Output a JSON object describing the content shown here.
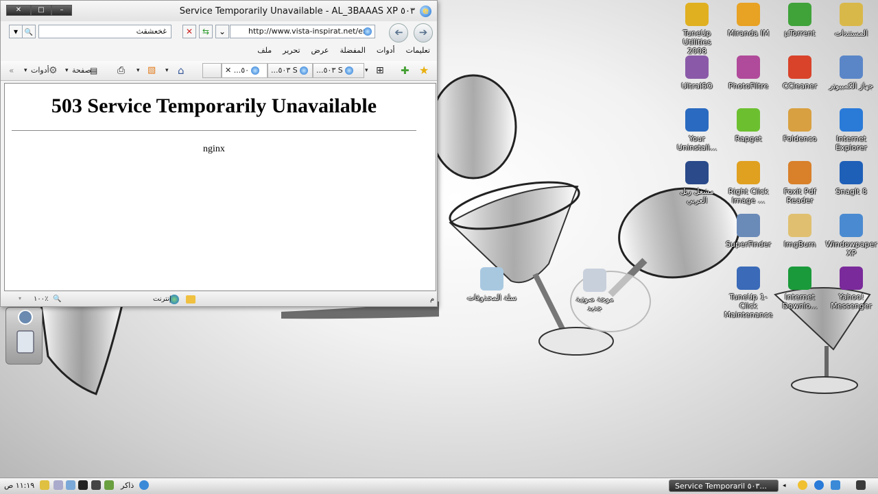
{
  "window": {
    "title": "Service Temporarily Unavailable - AL_3BAAAS XP ٥٠٣",
    "caption_minimize": "–",
    "caption_maximize": "□",
    "caption_close": "✕"
  },
  "address_bar": {
    "url": "http://www.vista-inspirat.net/en/",
    "dropdown_glyph": "⌄",
    "refresh_glyph": "⇆",
    "stop_glyph": "✕",
    "search_value": "غخعشقث",
    "search_glyph": "🔍",
    "search_dropdown_glyph": "▾"
  },
  "menu": {
    "items": [
      "ملف",
      "تحرير",
      "عرض",
      "المفضلة",
      "أدوات",
      "تعليمات"
    ]
  },
  "toolbar": {
    "tools_label": "أدوات",
    "page_label": "صفحة",
    "tabs": [
      {
        "label": "...٥٠٣ S"
      },
      {
        "label": "...٥٠٣ S"
      },
      {
        "label": "...٥٠"
      }
    ],
    "tab_close": "✕"
  },
  "page": {
    "heading": "503 Service Temporarily Unavailable",
    "server": "nginx"
  },
  "status_bar": {
    "left_char": "م",
    "zone": "إنترنت",
    "zoom": "١٠٠٪"
  },
  "desktop_icons": [
    {
      "label": "المستندات",
      "icon": "folder-icon",
      "color": "#d9b84a"
    },
    {
      "label": "µTorrent",
      "icon": "utorrent-icon",
      "color": "#3fa33a"
    },
    {
      "label": "Miranda IM",
      "icon": "miranda-icon",
      "color": "#e8a224"
    },
    {
      "label": "TuneUp Utilities\n2008",
      "icon": "tuneup-icon",
      "color": "#e0b020"
    },
    {
      "label": "جهاز الكمبيوتر",
      "icon": "computer-icon",
      "color": "#5a86c8"
    },
    {
      "label": "CCleaner",
      "icon": "ccleaner-icon",
      "color": "#d8432a"
    },
    {
      "label": "PhotoFiltre",
      "icon": "photofiltre-icon",
      "color": "#b04a9a"
    },
    {
      "label": "UltraISO",
      "icon": "ultraiso-icon",
      "color": "#8a5aa8"
    },
    {
      "label": "Internet\nExplorer",
      "icon": "internet-explorer-icon",
      "color": "#2a7ad8"
    },
    {
      "label": "Foldenco",
      "icon": "foldenco-icon",
      "color": "#d8a040"
    },
    {
      "label": "Rapget",
      "icon": "rapget-icon",
      "color": "#6cc030"
    },
    {
      "label": "Your\nUninstall...",
      "icon": "uninstaller-icon",
      "color": "#2a6ac0"
    },
    {
      "label": "SnagIt 8",
      "icon": "snagit-icon",
      "color": "#1e5fb8"
    },
    {
      "label": "Foxit Pdf\nReader",
      "icon": "foxit-icon",
      "color": "#d8802a"
    },
    {
      "label": "Right Click\nImage ...",
      "icon": "gear-image-icon",
      "color": "#e0a020"
    },
    {
      "label": "مشغل ريل\nالعربي",
      "icon": "real-player-icon",
      "color": "#2a4a8a"
    },
    {
      "label": "Windowpaper\nXP",
      "icon": "windowpaper-icon",
      "color": "#4a8ad0"
    },
    {
      "label": "ImgBurn",
      "icon": "imgburn-icon",
      "color": "#e0c070"
    },
    {
      "label": "SuperFinder",
      "icon": "superfinder-icon",
      "color": "#6a8ab8"
    },
    {
      "label": "Yahoo!\nMessenger",
      "icon": "yahoo-messenger-icon",
      "color": "#7a2a9a"
    },
    {
      "label": "Internet\nDownlo...",
      "icon": "idm-icon",
      "color": "#1a9a3a"
    },
    {
      "label": "TuneUp 1-Click\nMaintenance",
      "icon": "tuneup-maintenance-icon",
      "color": "#3a6ab8"
    },
    {
      "label": "موجة صوتية\nجديد",
      "icon": "wav-file-icon",
      "color": "#c8d0dc"
    },
    {
      "label": "سلة المحذوفات",
      "icon": "recycle-bin-icon",
      "color": "#a8c8e0"
    }
  ],
  "taskbar": {
    "active_task": "Service Temporaril ٥٠٣...",
    "clock": "١١:١٩ ص",
    "lang": "ذاكر"
  }
}
